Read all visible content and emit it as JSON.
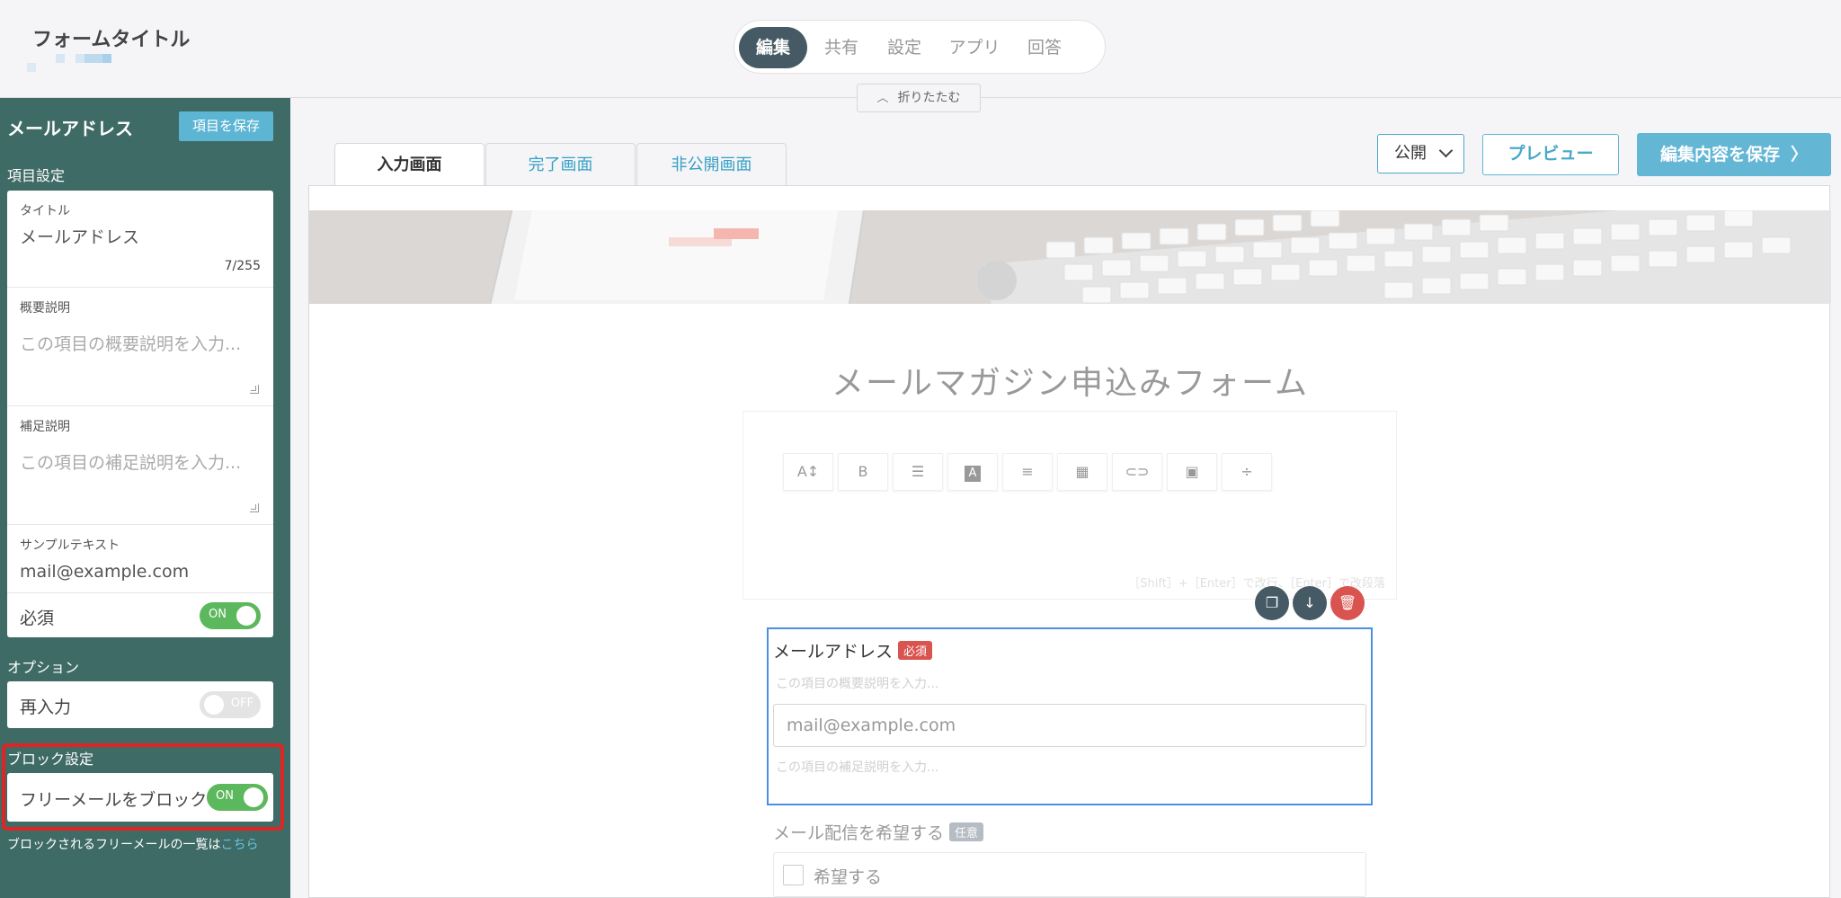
{
  "header": {
    "form_title": "フォームタイトル",
    "nav": [
      "編集",
      "共有",
      "設定",
      "アプリ",
      "回答"
    ],
    "collapse_label": "折りたたむ"
  },
  "sidebar": {
    "title": "メールアドレス",
    "save_label": "項目を保存",
    "item_settings_label": "項目設定",
    "title_field_label": "タイトル",
    "title_field_value": "メールアドレス",
    "title_counter": "7/255",
    "summary_label": "概要説明",
    "summary_placeholder": "この項目の概要説明を入力...",
    "supplement_label": "補足説明",
    "supplement_placeholder": "この項目の補足説明を入力...",
    "sample_label": "サンプルテキスト",
    "sample_value": "mail@example.com",
    "required_label": "必須",
    "required_toggle": "ON",
    "options_label": "オプション",
    "reentry_label": "再入力",
    "reentry_toggle": "OFF",
    "block_settings_label": "ブロック設定",
    "block_free_label": "フリーメールをブロック",
    "block_free_toggle": "ON",
    "block_note": "ブロックされるフリーメールの一覧は",
    "block_note_link": "こちら"
  },
  "main": {
    "tabs": [
      "入力画面",
      "完了画面",
      "非公開画面"
    ],
    "publish_select": "公開",
    "preview_label": "プレビュー",
    "save_label": "編集内容を保存",
    "form_heading": "メールマガジン申込みフォーム",
    "editor_hint": "［Shift］+［Enter］で改行、［Enter］で改段落",
    "field": {
      "title": "メールアドレス",
      "required_badge": "必須",
      "desc_placeholder": "この項目の概要説明を入力...",
      "input_placeholder": "mail@example.com",
      "sub_placeholder": "この項目の補足説明を入力..."
    },
    "next_field": {
      "title": "メール配信を希望する",
      "optional_badge": "任意",
      "option_label": "希望する"
    }
  },
  "colors": {
    "sidebar_bg": "#3f6b66",
    "accent": "#5db5d4",
    "toggle_on": "#5cb85c",
    "required_red": "#d9534f",
    "selection_blue": "#4a90e2",
    "highlight_red": "#e02424"
  }
}
